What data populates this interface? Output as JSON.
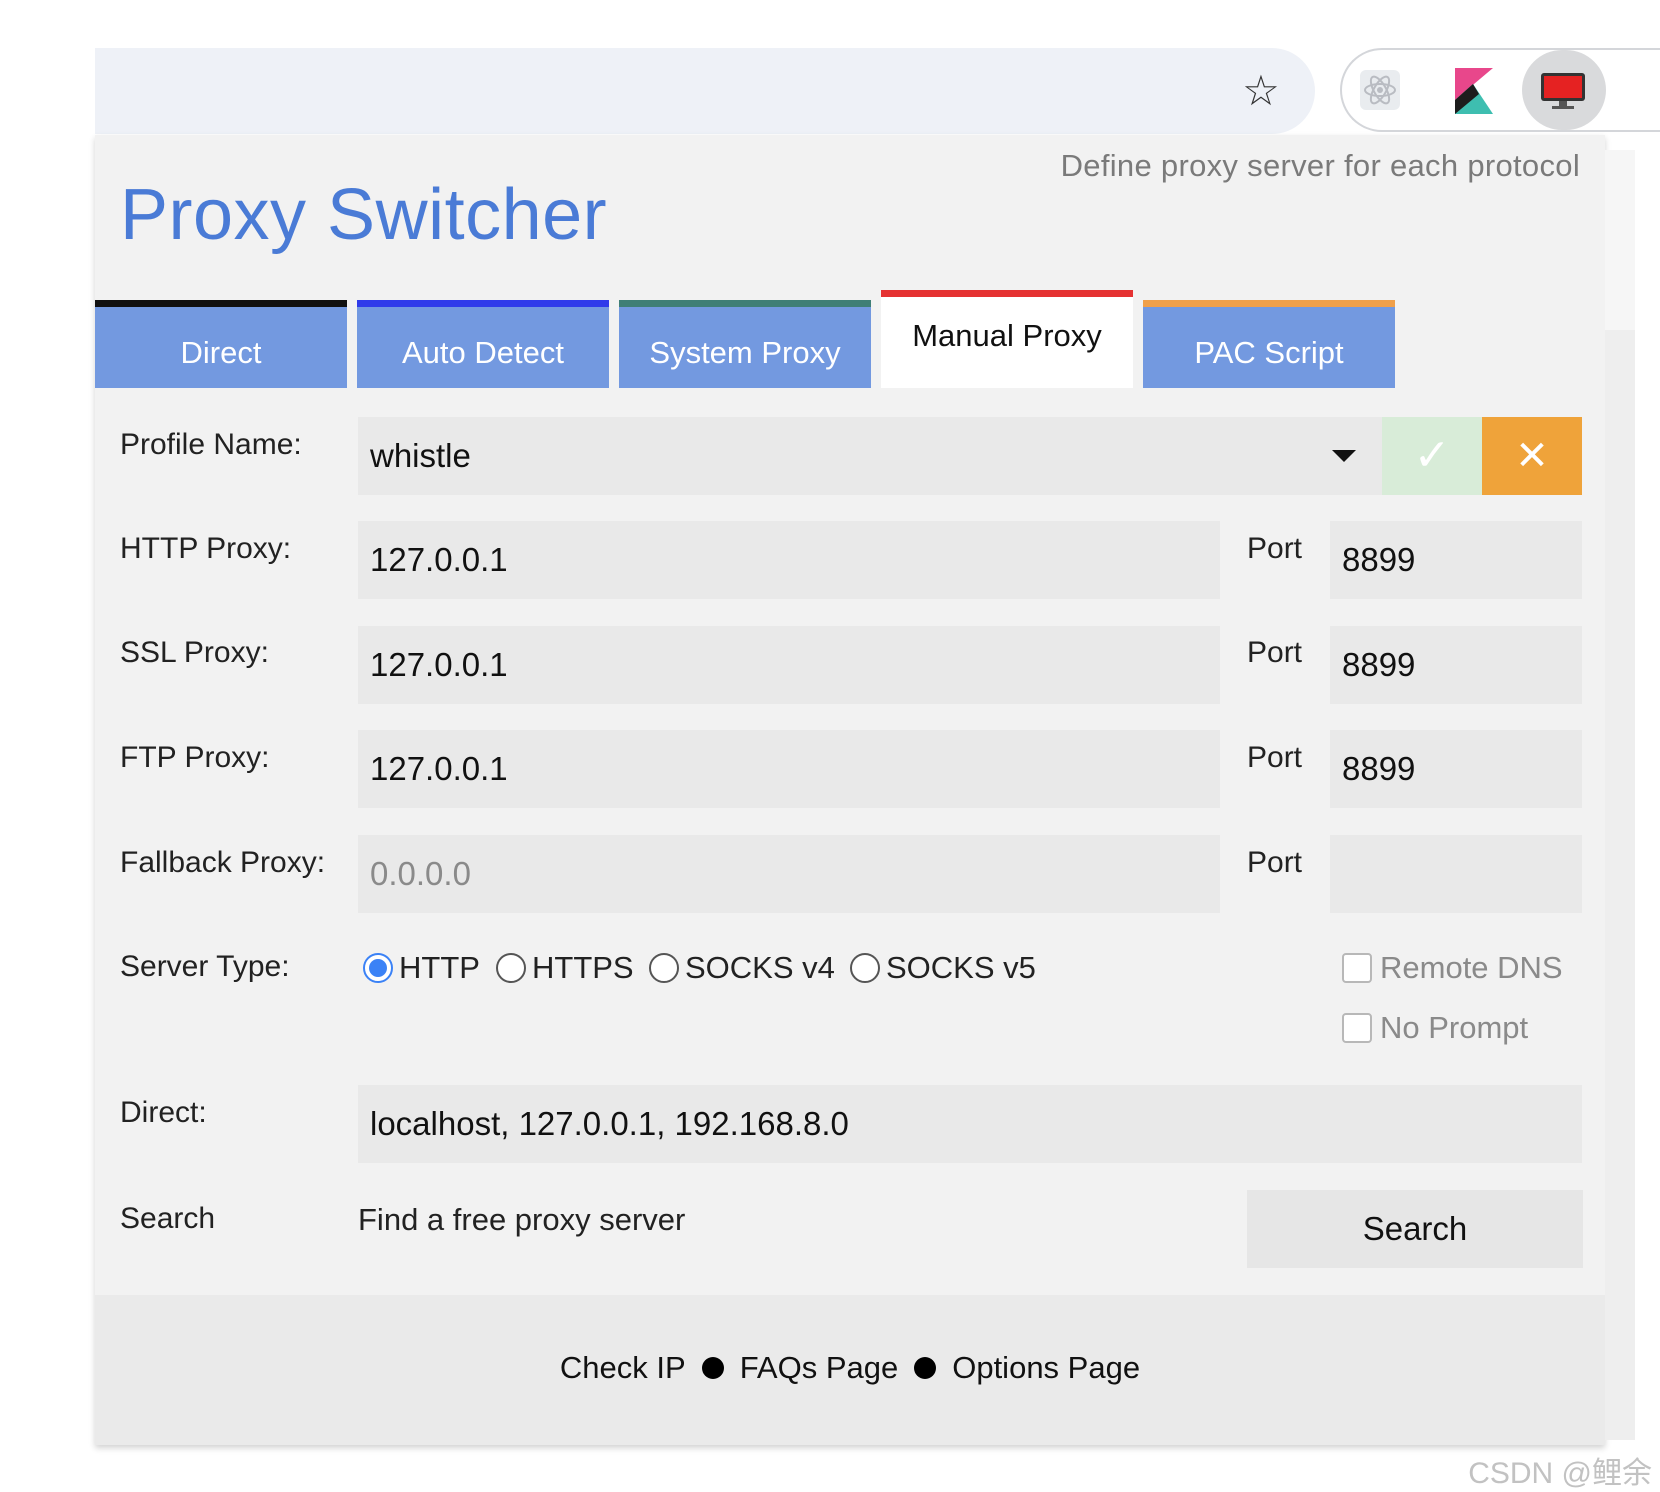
{
  "toolbar": {
    "bookmark_icon": "star-icon",
    "extensions": [
      "react-devtools-icon",
      "kibana-k-icon",
      "proxy-switcher-monitor-icon"
    ]
  },
  "app": {
    "title": "Proxy Switcher",
    "hint": "Define proxy server for each protocol"
  },
  "tabs": [
    {
      "label": "Direct",
      "color": "#111111",
      "active": false
    },
    {
      "label": "Auto Detect",
      "color": "#2f3bea",
      "active": false
    },
    {
      "label": "System Proxy",
      "color": "#3f7f76",
      "active": false
    },
    {
      "label": "Manual Proxy",
      "color": "#e53232",
      "active": true
    },
    {
      "label": "PAC Script",
      "color": "#f0a04a",
      "active": false
    }
  ],
  "form": {
    "profile_label": "Profile Name:",
    "profile_value": "whistle",
    "confirm_icon": "checkmark-icon",
    "cancel_icon": "close-icon",
    "http_label": "HTTP Proxy:",
    "http_value": "127.0.0.1",
    "http_port": "8899",
    "ssl_label": "SSL Proxy:",
    "ssl_value": "127.0.0.1",
    "ssl_port": "8899",
    "ftp_label": "FTP Proxy:",
    "ftp_value": "127.0.0.1",
    "ftp_port": "8899",
    "fallback_label": "Fallback Proxy:",
    "fallback_placeholder": "0.0.0.0",
    "fallback_port": "",
    "port_label": "Port",
    "server_type_label": "Server Type:",
    "server_types": [
      {
        "label": "HTTP",
        "checked": true
      },
      {
        "label": "HTTPS",
        "checked": false
      },
      {
        "label": "SOCKS v4",
        "checked": false
      },
      {
        "label": "SOCKS v5",
        "checked": false
      }
    ],
    "remote_dns_label": "Remote DNS",
    "no_prompt_label": "No Prompt",
    "direct_label": "Direct:",
    "direct_value": "localhost, 127.0.0.1, 192.168.8.0",
    "search_label": "Search",
    "search_hint": "Find a free proxy server",
    "search_button": "Search"
  },
  "footer": {
    "check_ip": "Check IP",
    "faqs": "FAQs Page",
    "options": "Options Page"
  },
  "watermark": "CSDN @鲤余"
}
